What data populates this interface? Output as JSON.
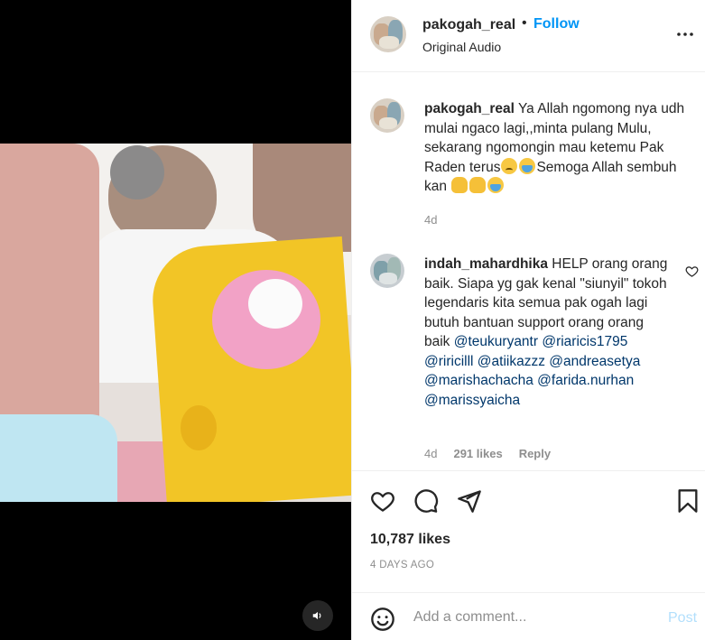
{
  "media": {
    "audio_icon": "speaker-icon"
  },
  "header": {
    "username": "pakogah_real",
    "separator": "•",
    "follow_label": "Follow",
    "subtitle": "Original Audio",
    "more_icon": "more-horizontal-icon"
  },
  "caption": {
    "username": "pakogah_real",
    "text_part1": "Ya Allah ngomong nya udh mulai ngaco lagi,,minta pulang Mulu, sekarang ngomongin mau ketemu Pak Raden terus",
    "text_part2": "Semoga Allah sembuh kan",
    "time": "4d"
  },
  "comment": {
    "username": "indah_mahardhika",
    "text": "HELP orang orang baik. Siapa yg gak kenal \"siunyil\" tokoh legendaris kita semua pak ogah lagi butuh bantuan support orang orang baik",
    "mentions": [
      "@teukuryantr",
      "@riaricis1795",
      "@riricilll",
      "@atiikazzz",
      "@andreasetya",
      "@marishachacha",
      "@farida.nurhan",
      "@marissyaicha"
    ],
    "time": "4d",
    "likes": "291 likes",
    "reply_label": "Reply"
  },
  "actions": {
    "like_icon": "heart-icon",
    "comment_icon": "comment-icon",
    "share_icon": "paper-plane-icon",
    "save_icon": "bookmark-icon",
    "likes_count": "10,787 likes",
    "posted": "4 DAYS AGO"
  },
  "add_comment": {
    "emoji_icon": "smiley-icon",
    "placeholder": "Add a comment...",
    "post_label": "Post"
  },
  "colors": {
    "accent": "#0095f6",
    "mention": "#00376b",
    "muted": "#8e8e8e",
    "post_disabled": "#b2dffc"
  }
}
